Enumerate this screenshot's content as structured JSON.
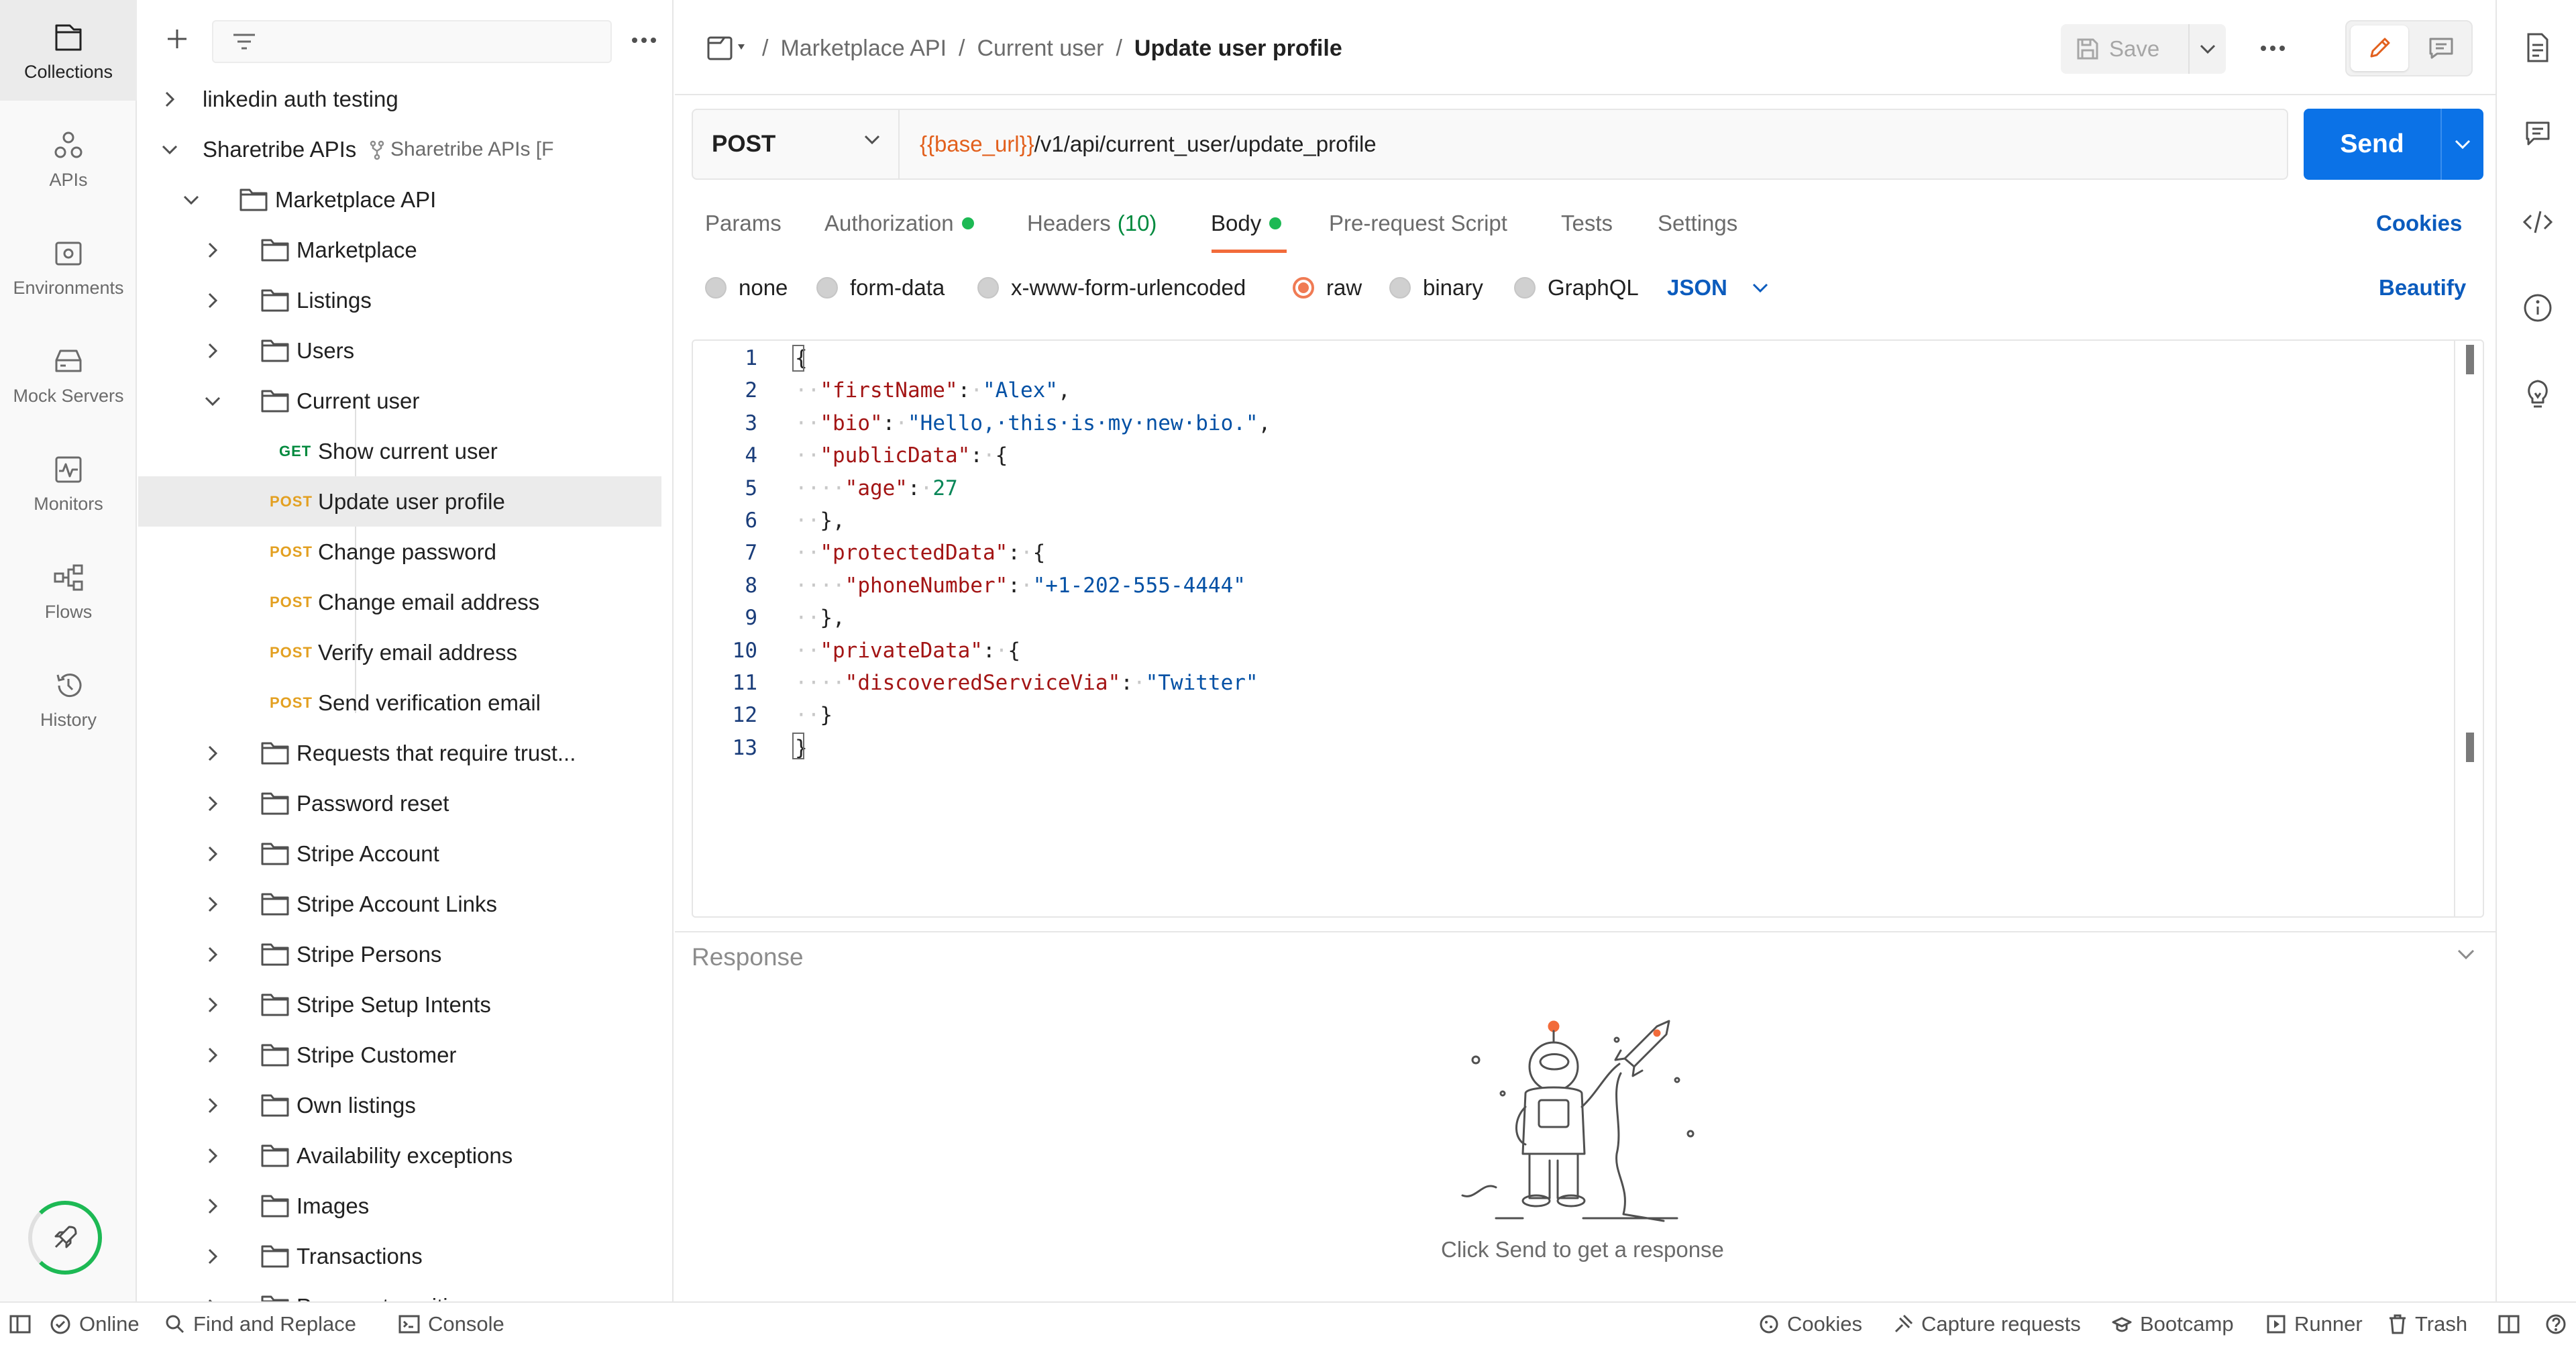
{
  "rail": {
    "items": [
      {
        "label": "Collections",
        "icon": "collections-icon",
        "active": true
      },
      {
        "label": "APIs",
        "icon": "apis-icon"
      },
      {
        "label": "Environments",
        "icon": "environments-icon"
      },
      {
        "label": "Mock Servers",
        "icon": "mock-servers-icon"
      },
      {
        "label": "Monitors",
        "icon": "monitors-icon"
      },
      {
        "label": "Flows",
        "icon": "flows-icon"
      },
      {
        "label": "History",
        "icon": "history-icon"
      }
    ]
  },
  "sidebar": {
    "tree": [
      {
        "label": "linkedin auth testing",
        "type": "collection"
      },
      {
        "label": "Sharetribe APIs",
        "fork": "Sharetribe APIs [F",
        "type": "collection"
      },
      {
        "label": "Marketplace API",
        "type": "folder"
      },
      {
        "label": "Marketplace",
        "type": "folder"
      },
      {
        "label": "Listings",
        "type": "folder"
      },
      {
        "label": "Users",
        "type": "folder"
      },
      {
        "label": "Current user",
        "type": "folder"
      },
      {
        "label": "Show current user",
        "method": "GET",
        "type": "request"
      },
      {
        "label": "Update user profile",
        "method": "POST",
        "type": "request",
        "selected": true
      },
      {
        "label": "Change password",
        "method": "POST",
        "type": "request"
      },
      {
        "label": "Change email address",
        "method": "POST",
        "type": "request"
      },
      {
        "label": "Verify email address",
        "method": "POST",
        "type": "request"
      },
      {
        "label": "Send verification email",
        "method": "POST",
        "type": "request"
      },
      {
        "label": "Requests that require trust...",
        "type": "folder"
      },
      {
        "label": "Password reset",
        "type": "folder"
      },
      {
        "label": "Stripe Account",
        "type": "folder"
      },
      {
        "label": "Stripe Account Links",
        "type": "folder"
      },
      {
        "label": "Stripe Persons",
        "type": "folder"
      },
      {
        "label": "Stripe Setup Intents",
        "type": "folder"
      },
      {
        "label": "Stripe Customer",
        "type": "folder"
      },
      {
        "label": "Own listings",
        "type": "folder"
      },
      {
        "label": "Availability exceptions",
        "type": "folder"
      },
      {
        "label": "Images",
        "type": "folder"
      },
      {
        "label": "Transactions",
        "type": "folder"
      },
      {
        "label": "Process transitions",
        "type": "folder"
      }
    ]
  },
  "topbar": {
    "breadcrumb": [
      "Marketplace API",
      "Current user"
    ],
    "current": "Update user profile",
    "save_label": "Save"
  },
  "request": {
    "method": "POST",
    "url_var": "{{base_url}}",
    "url_path": "/v1/api/current_user/update_profile",
    "send_label": "Send"
  },
  "tabs": [
    {
      "label": "Params"
    },
    {
      "label": "Authorization",
      "dot": true
    },
    {
      "label": "Headers",
      "count": "(10)"
    },
    {
      "label": "Body",
      "dot": true,
      "active": true
    },
    {
      "label": "Pre-request Script"
    },
    {
      "label": "Tests"
    },
    {
      "label": "Settings"
    }
  ],
  "cookies_label": "Cookies",
  "body_types": [
    {
      "label": "none"
    },
    {
      "label": "form-data"
    },
    {
      "label": "x-www-form-urlencoded"
    },
    {
      "label": "raw",
      "selected": true
    },
    {
      "label": "binary"
    },
    {
      "label": "GraphQL"
    }
  ],
  "body_format": "JSON",
  "beautify_label": "Beautify",
  "editor": {
    "lines": [
      [
        [
          "p",
          "{"
        ]
      ],
      [
        [
          "ws",
          "··"
        ],
        [
          "k",
          "\"firstName\""
        ],
        [
          "p",
          ":"
        ],
        [
          "ws",
          "·"
        ],
        [
          "s",
          "\"Alex\""
        ],
        [
          "p",
          ","
        ]
      ],
      [
        [
          "ws",
          "··"
        ],
        [
          "k",
          "\"bio\""
        ],
        [
          "p",
          ":"
        ],
        [
          "ws",
          "·"
        ],
        [
          "s",
          "\"Hello,·this·is·my·new·bio.\""
        ],
        [
          "p",
          ","
        ]
      ],
      [
        [
          "ws",
          "··"
        ],
        [
          "k",
          "\"publicData\""
        ],
        [
          "p",
          ":"
        ],
        [
          "ws",
          "·"
        ],
        [
          "p",
          "{"
        ]
      ],
      [
        [
          "ws",
          "····"
        ],
        [
          "k",
          "\"age\""
        ],
        [
          "p",
          ":"
        ],
        [
          "ws",
          "·"
        ],
        [
          "n",
          "27"
        ]
      ],
      [
        [
          "ws",
          "··"
        ],
        [
          "p",
          "},"
        ]
      ],
      [
        [
          "ws",
          "··"
        ],
        [
          "k",
          "\"protectedData\""
        ],
        [
          "p",
          ":"
        ],
        [
          "ws",
          "·"
        ],
        [
          "p",
          "{"
        ]
      ],
      [
        [
          "ws",
          "····"
        ],
        [
          "k",
          "\"phoneNumber\""
        ],
        [
          "p",
          ":"
        ],
        [
          "ws",
          "·"
        ],
        [
          "s",
          "\"+1-202-555-4444\""
        ]
      ],
      [
        [
          "ws",
          "··"
        ],
        [
          "p",
          "},"
        ]
      ],
      [
        [
          "ws",
          "··"
        ],
        [
          "k",
          "\"privateData\""
        ],
        [
          "p",
          ":"
        ],
        [
          "ws",
          "·"
        ],
        [
          "p",
          "{"
        ]
      ],
      [
        [
          "ws",
          "····"
        ],
        [
          "k",
          "\"discoveredServiceVia\""
        ],
        [
          "p",
          ":"
        ],
        [
          "ws",
          "·"
        ],
        [
          "s",
          "\"Twitter\""
        ]
      ],
      [
        [
          "ws",
          "··"
        ],
        [
          "p",
          "}"
        ]
      ],
      [
        [
          "p",
          "}"
        ]
      ]
    ]
  },
  "response": {
    "title": "Response",
    "hint": "Click Send to get a response"
  },
  "status": {
    "online": "Online",
    "find_replace": "Find and Replace",
    "console": "Console",
    "cookies": "Cookies",
    "capture": "Capture requests",
    "bootcamp": "Bootcamp",
    "runner": "Runner",
    "trash": "Trash"
  }
}
